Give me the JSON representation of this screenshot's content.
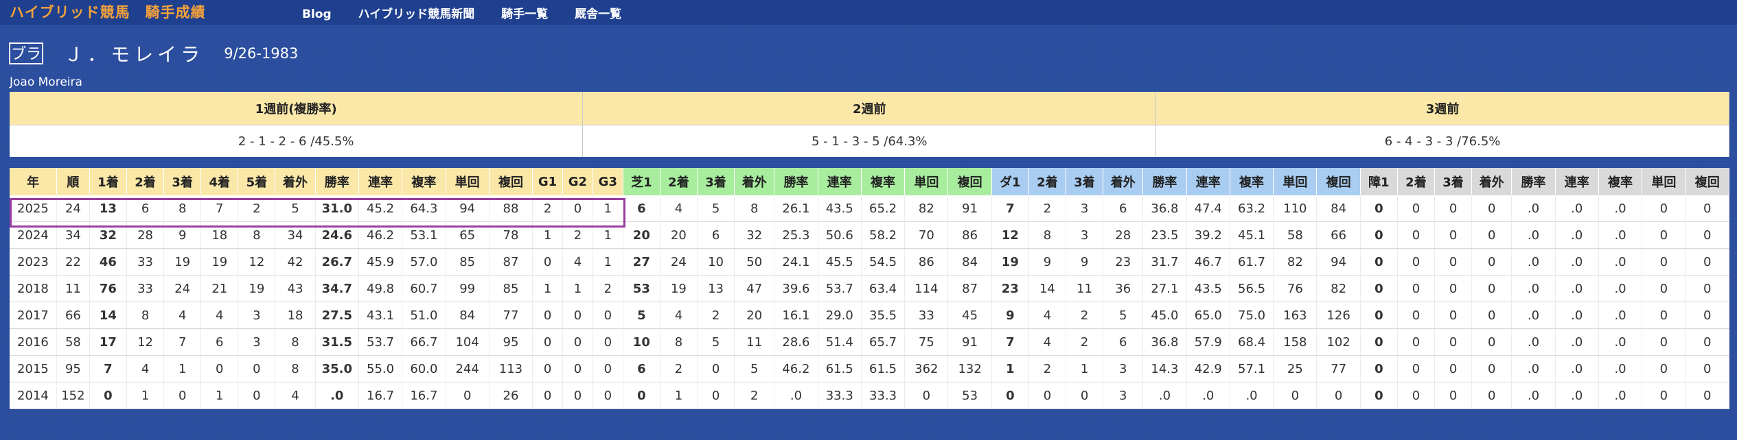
{
  "site": {
    "title": "ハイブリッド競馬　騎手成績",
    "nav": [
      "Blog",
      "ハイブリッド競馬新聞",
      "騎手一覧",
      "厩舎一覧"
    ]
  },
  "jockey": {
    "flag": "ブラ",
    "name": "Ｊ．モレイラ",
    "birthday": "9/26-1983",
    "romaji": "Joao Moreira"
  },
  "weeks": {
    "headers": [
      "1週前(複勝率)",
      "2週前",
      "3週前"
    ],
    "values": [
      "2 - 1 - 2 - 6 /45.5%",
      "5 - 1 - 3 - 5 /64.3%",
      "6 - 4 - 3 - 3 /76.5%"
    ]
  },
  "stats": {
    "headers": [
      {
        "label": "年",
        "group": "g"
      },
      {
        "label": "順",
        "group": "g"
      },
      {
        "label": "1着",
        "group": "g"
      },
      {
        "label": "2着",
        "group": "g"
      },
      {
        "label": "3着",
        "group": "g"
      },
      {
        "label": "4着",
        "group": "g"
      },
      {
        "label": "5着",
        "group": "g"
      },
      {
        "label": "着外",
        "group": "g"
      },
      {
        "label": "勝率",
        "group": "g"
      },
      {
        "label": "連率",
        "group": "g"
      },
      {
        "label": "複率",
        "group": "g"
      },
      {
        "label": "単回",
        "group": "g"
      },
      {
        "label": "複回",
        "group": "g"
      },
      {
        "label": "G1",
        "group": "g"
      },
      {
        "label": "G2",
        "group": "g"
      },
      {
        "label": "G3",
        "group": "g"
      },
      {
        "label": "芝1",
        "group": "t"
      },
      {
        "label": "2着",
        "group": "t"
      },
      {
        "label": "3着",
        "group": "t"
      },
      {
        "label": "着外",
        "group": "t"
      },
      {
        "label": "勝率",
        "group": "t"
      },
      {
        "label": "連率",
        "group": "t"
      },
      {
        "label": "複率",
        "group": "t"
      },
      {
        "label": "単回",
        "group": "t"
      },
      {
        "label": "複回",
        "group": "t"
      },
      {
        "label": "ダ1",
        "group": "d"
      },
      {
        "label": "2着",
        "group": "d"
      },
      {
        "label": "3着",
        "group": "d"
      },
      {
        "label": "着外",
        "group": "d"
      },
      {
        "label": "勝率",
        "group": "d"
      },
      {
        "label": "連率",
        "group": "d"
      },
      {
        "label": "複率",
        "group": "d"
      },
      {
        "label": "単回",
        "group": "d"
      },
      {
        "label": "複回",
        "group": "d"
      },
      {
        "label": "障1",
        "group": "s"
      },
      {
        "label": "2着",
        "group": "s"
      },
      {
        "label": "3着",
        "group": "s"
      },
      {
        "label": "着外",
        "group": "s"
      },
      {
        "label": "勝率",
        "group": "s"
      },
      {
        "label": "連率",
        "group": "s"
      },
      {
        "label": "複率",
        "group": "s"
      },
      {
        "label": "単回",
        "group": "s"
      },
      {
        "label": "複回",
        "group": "s"
      }
    ],
    "rows": [
      [
        "2025",
        "24",
        "13",
        "6",
        "8",
        "7",
        "2",
        "5",
        "31.0",
        "45.2",
        "64.3",
        "94",
        "88",
        "2",
        "0",
        "1",
        "6",
        "4",
        "5",
        "8",
        "26.1",
        "43.5",
        "65.2",
        "82",
        "91",
        "7",
        "2",
        "3",
        "6",
        "36.8",
        "47.4",
        "63.2",
        "110",
        "84",
        "0",
        "0",
        "0",
        "0",
        ".0",
        ".0",
        ".0",
        "0",
        "0"
      ],
      [
        "2024",
        "34",
        "32",
        "28",
        "9",
        "18",
        "8",
        "34",
        "24.6",
        "46.2",
        "53.1",
        "65",
        "78",
        "1",
        "2",
        "1",
        "20",
        "20",
        "6",
        "32",
        "25.3",
        "50.6",
        "58.2",
        "70",
        "86",
        "12",
        "8",
        "3",
        "28",
        "23.5",
        "39.2",
        "45.1",
        "58",
        "66",
        "0",
        "0",
        "0",
        "0",
        ".0",
        ".0",
        ".0",
        "0",
        "0"
      ],
      [
        "2023",
        "22",
        "46",
        "33",
        "19",
        "19",
        "12",
        "42",
        "26.7",
        "45.9",
        "57.0",
        "85",
        "87",
        "0",
        "4",
        "1",
        "27",
        "24",
        "10",
        "50",
        "24.1",
        "45.5",
        "54.5",
        "86",
        "84",
        "19",
        "9",
        "9",
        "23",
        "31.7",
        "46.7",
        "61.7",
        "82",
        "94",
        "0",
        "0",
        "0",
        "0",
        ".0",
        ".0",
        ".0",
        "0",
        "0"
      ],
      [
        "2018",
        "11",
        "76",
        "33",
        "24",
        "21",
        "19",
        "43",
        "34.7",
        "49.8",
        "60.7",
        "99",
        "85",
        "1",
        "1",
        "2",
        "53",
        "19",
        "13",
        "47",
        "39.6",
        "53.7",
        "63.4",
        "114",
        "87",
        "23",
        "14",
        "11",
        "36",
        "27.1",
        "43.5",
        "56.5",
        "76",
        "82",
        "0",
        "0",
        "0",
        "0",
        ".0",
        ".0",
        ".0",
        "0",
        "0"
      ],
      [
        "2017",
        "66",
        "14",
        "8",
        "4",
        "4",
        "3",
        "18",
        "27.5",
        "43.1",
        "51.0",
        "84",
        "77",
        "0",
        "0",
        "0",
        "5",
        "4",
        "2",
        "20",
        "16.1",
        "29.0",
        "35.5",
        "33",
        "45",
        "9",
        "4",
        "2",
        "5",
        "45.0",
        "65.0",
        "75.0",
        "163",
        "126",
        "0",
        "0",
        "0",
        "0",
        ".0",
        ".0",
        ".0",
        "0",
        "0"
      ],
      [
        "2016",
        "58",
        "17",
        "12",
        "7",
        "6",
        "3",
        "8",
        "31.5",
        "53.7",
        "66.7",
        "104",
        "95",
        "0",
        "0",
        "0",
        "10",
        "8",
        "5",
        "11",
        "28.6",
        "51.4",
        "65.7",
        "75",
        "91",
        "7",
        "4",
        "2",
        "6",
        "36.8",
        "57.9",
        "68.4",
        "158",
        "102",
        "0",
        "0",
        "0",
        "0",
        ".0",
        ".0",
        ".0",
        "0",
        "0"
      ],
      [
        "2015",
        "95",
        "7",
        "4",
        "1",
        "0",
        "0",
        "8",
        "35.0",
        "55.0",
        "60.0",
        "244",
        "113",
        "0",
        "0",
        "0",
        "6",
        "2",
        "0",
        "5",
        "46.2",
        "61.5",
        "61.5",
        "362",
        "132",
        "1",
        "2",
        "1",
        "3",
        "14.3",
        "42.9",
        "57.1",
        "25",
        "77",
        "0",
        "0",
        "0",
        "0",
        ".0",
        ".0",
        ".0",
        "0",
        "0"
      ],
      [
        "2014",
        "152",
        "0",
        "1",
        "0",
        "1",
        "0",
        "4",
        ".0",
        "16.7",
        "16.7",
        "0",
        "26",
        "0",
        "0",
        "0",
        "0",
        "1",
        "0",
        "2",
        ".0",
        "33.3",
        "33.3",
        "0",
        "53",
        "0",
        "0",
        "0",
        "3",
        ".0",
        ".0",
        ".0",
        "0",
        "0",
        "0",
        "0",
        "0",
        "0",
        ".0",
        ".0",
        ".0",
        "0",
        "0"
      ]
    ]
  },
  "colors": {
    "background": "#2a4d9e",
    "title_accent": "#f4a23a",
    "general_header": "#fbe7a8",
    "turf_header": "#a8ec9e",
    "dirt_header": "#a9cdf2",
    "jump_header": "#d9d9d9",
    "row_highlight": "#9a3da0"
  }
}
